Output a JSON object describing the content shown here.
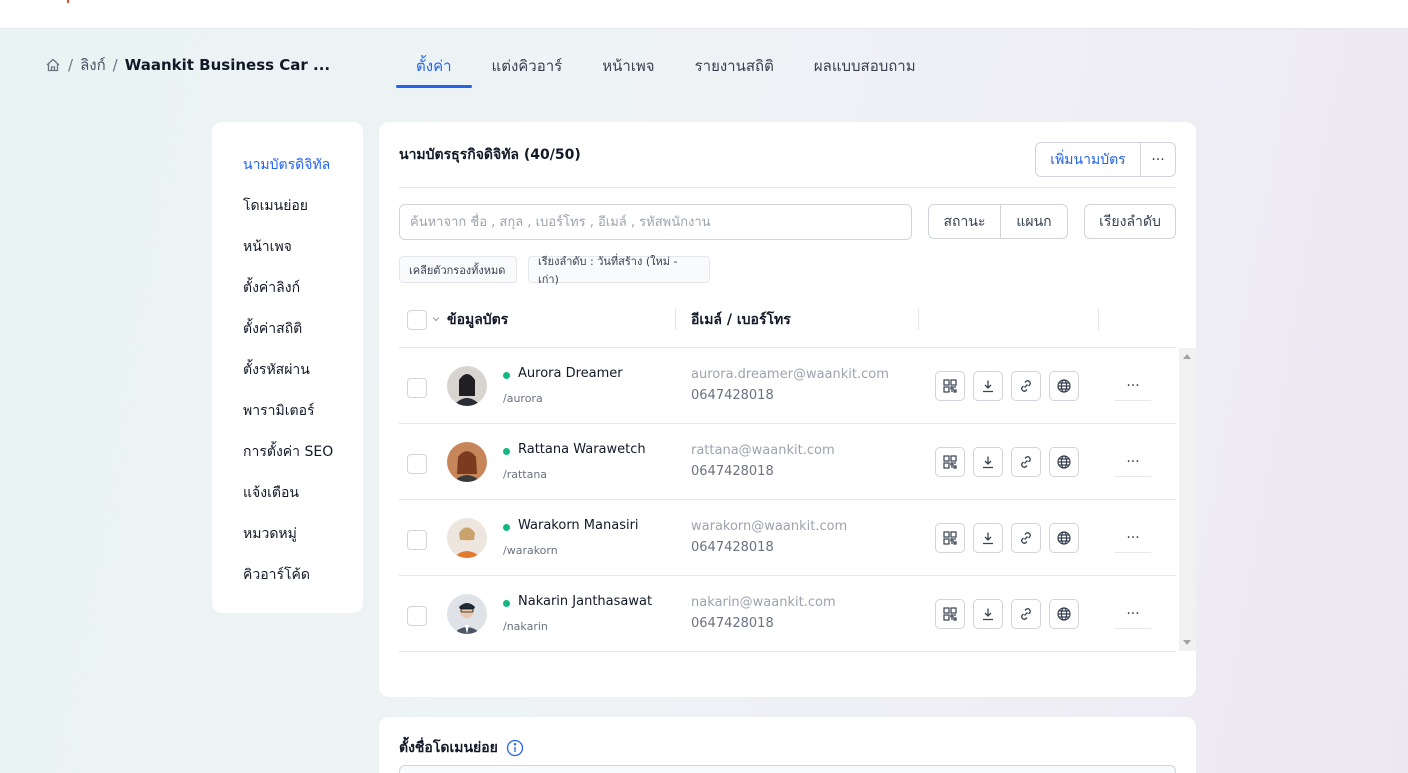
{
  "breadcrumb": {
    "home_icon": "home-icon",
    "sep": "/",
    "link": "ลิงก์",
    "current": "Waankit Business Car ..."
  },
  "tabs": [
    {
      "label": "ตั้งค่า",
      "active": true
    },
    {
      "label": "แต่งคิวอาร์"
    },
    {
      "label": "หน้าเพจ"
    },
    {
      "label": "รายงานสถิติ"
    },
    {
      "label": "ผลแบบสอบถาม"
    }
  ],
  "sidebar": {
    "items": [
      {
        "label": "นามบัตรดิจิทัล",
        "active": true
      },
      {
        "label": "โดเมนย่อย"
      },
      {
        "label": "หน้าเพจ"
      },
      {
        "label": "ตั้งค่าลิงก์"
      },
      {
        "label": "ตั้งค่าสถิติ"
      },
      {
        "label": "ตั้งรหัสผ่าน"
      },
      {
        "label": "พารามิเตอร์"
      },
      {
        "label": "การตั้งค่า SEO"
      },
      {
        "label": "แจ้งเตือน"
      },
      {
        "label": "หมวดหมู่"
      },
      {
        "label": "คิวอาร์โค้ด"
      }
    ]
  },
  "card": {
    "title": "นามบัตรธุรกิจดิจิทัล (40/50)",
    "add_label": "เพิ่มนามบัตร",
    "more_label": "···",
    "search_placeholder": "ค้นหาจาก ชื่อ , สกุล , เบอร์โทร , อีเมล์ , รหัสพนักงาน",
    "status_label": "สถานะ",
    "dept_label": "แผนก",
    "sort_label": "เรียงลำดับ",
    "chip_clear": "เคลียตัวกรองทั้งหมด",
    "chip_sort": "เรียงลำดับ : วันที่สร้าง (ใหม่ - เก่า)",
    "col_info": "ข้อมูลบัตร",
    "col_contact": "อีเมล์ / เบอร์โทร"
  },
  "rows": [
    {
      "name": "Aurora Dreamer",
      "slug": "/aurora",
      "email": "aurora.dreamer@waankit.com",
      "phone": "0647428018",
      "more": "···",
      "avatar_color": "#2d2d35"
    },
    {
      "name": "Rattana Warawetch",
      "slug": "/rattana",
      "email": "rattana@waankit.com",
      "phone": "0647428018",
      "more": "···",
      "avatar_color": "#b5643a"
    },
    {
      "name": "Warakorn Manasiri",
      "slug": "/warakorn",
      "email": "warakorn@waankit.com",
      "phone": "0647428018",
      "more": "···",
      "avatar_color": "#e0c7a8"
    },
    {
      "name": "Nakarin Janthasawat",
      "slug": "/nakarin",
      "email": "nakarin@waankit.com",
      "phone": "0647428018",
      "more": "···",
      "avatar_color": "#4b5563"
    }
  ],
  "row_icons": [
    "qr-code-icon",
    "download-icon",
    "link-icon",
    "globe-icon"
  ],
  "card2": {
    "title": "ตั้งชื่อโดเมนย่อย",
    "info_icon": "info-icon"
  },
  "colors": {
    "accent": "#2563eb",
    "online": "#10b981"
  }
}
